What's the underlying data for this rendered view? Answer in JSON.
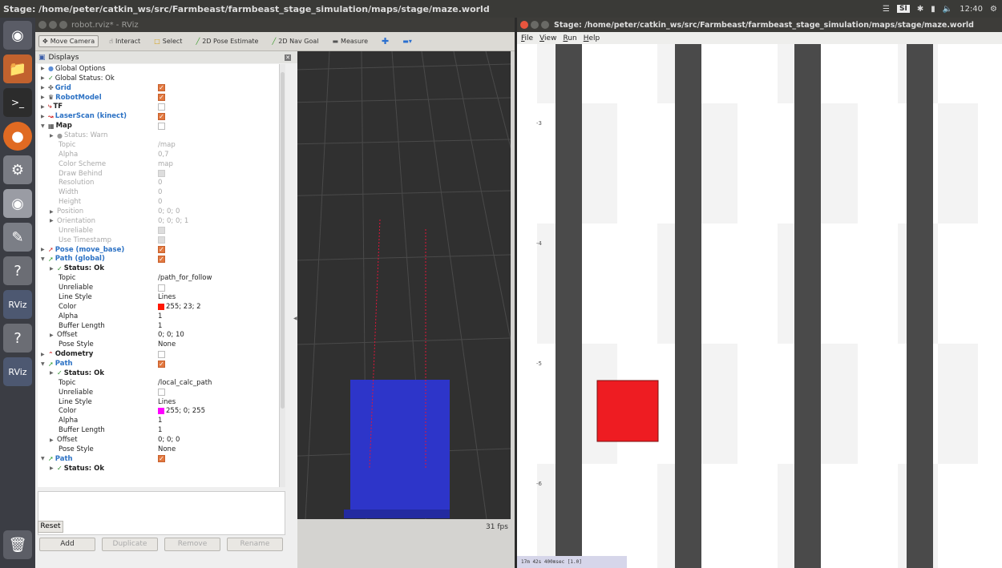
{
  "topbar": {
    "title": "Stage: /home/peter/catkin_ws/src/Farmbeast/farmbeast_stage_simulation/maps/stage/maze.world",
    "tray_badge": "SI",
    "clock": "12:40"
  },
  "launcher": {
    "items": [
      "ubuntu-dash-icon",
      "files-icon",
      "terminal-icon",
      "firefox-icon",
      "settings-icon",
      "camera-icon",
      "text-editor-icon",
      "help-icon",
      "rviz-icon",
      "help-icon",
      "rviz-icon",
      "trash-icon"
    ],
    "rviz_label": "RViz"
  },
  "rviz": {
    "title": "robot.rviz* - RViz",
    "tools": [
      {
        "label": "Move Camera",
        "icon": "move-camera-icon",
        "active": true
      },
      {
        "label": "Interact",
        "icon": "interact-icon"
      },
      {
        "label": "Select",
        "icon": "select-icon"
      },
      {
        "label": "2D Pose Estimate",
        "icon": "pose-estimate-icon"
      },
      {
        "label": "2D Nav Goal",
        "icon": "nav-goal-icon"
      },
      {
        "label": "Measure",
        "icon": "measure-icon"
      }
    ],
    "displays_title": "Displays",
    "rows": [
      {
        "name": "Global Options",
        "kind": "parent",
        "icon": "global-options-icon",
        "expanded": false,
        "indent": 0
      },
      {
        "name": "Global Status: Ok",
        "kind": "parent",
        "icon": "check-icon",
        "expanded": false,
        "indent": 0
      },
      {
        "name": "Grid",
        "kind": "display",
        "icon": "grid-icon",
        "expanded": false,
        "indent": 0,
        "checked": true
      },
      {
        "name": "RobotModel",
        "kind": "display",
        "icon": "robot-model-icon",
        "expanded": false,
        "indent": 0,
        "checked": true
      },
      {
        "name": "TF",
        "kind": "display",
        "icon": "tf-icon",
        "expanded": false,
        "indent": 0,
        "checked": false,
        "plain": true
      },
      {
        "name": "LaserScan (kinect)",
        "kind": "display",
        "icon": "laserscan-icon",
        "expanded": false,
        "indent": 0,
        "checked": true
      },
      {
        "name": "Map",
        "kind": "display",
        "icon": "map-icon",
        "expanded": true,
        "indent": 0,
        "checked": false,
        "plain": true
      },
      {
        "name": "Status: Warn",
        "kind": "prop",
        "icon": "warn-icon",
        "expanded": false,
        "indent": 1,
        "dim": true
      },
      {
        "name": "Topic",
        "value": "/map",
        "indent": 2,
        "dim": true
      },
      {
        "name": "Alpha",
        "value": "0,7",
        "indent": 2,
        "dim": true
      },
      {
        "name": "Color Scheme",
        "value": "map",
        "indent": 2,
        "dim": true
      },
      {
        "name": "Draw Behind",
        "checkbox": "disabled",
        "indent": 2,
        "dim": true
      },
      {
        "name": "Resolution",
        "value": "0",
        "indent": 2,
        "dim": true
      },
      {
        "name": "Width",
        "value": "0",
        "indent": 2,
        "dim": true
      },
      {
        "name": "Height",
        "value": "0",
        "indent": 2,
        "dim": true
      },
      {
        "name": "Position",
        "value": "0; 0; 0",
        "indent": 1,
        "dim": true,
        "expandable": true
      },
      {
        "name": "Orientation",
        "value": "0; 0; 0; 1",
        "indent": 1,
        "dim": true,
        "expandable": true
      },
      {
        "name": "Unreliable",
        "checkbox": "disabled",
        "indent": 2,
        "dim": true
      },
      {
        "name": "Use Timestamp",
        "checkbox": "disabled",
        "indent": 2,
        "dim": true
      },
      {
        "name": "Pose (move_base)",
        "kind": "display",
        "icon": "pose-icon",
        "expanded": false,
        "indent": 0,
        "checked": true
      },
      {
        "name": "Path (global)",
        "kind": "display",
        "icon": "path-icon",
        "expanded": true,
        "indent": 0,
        "checked": true
      },
      {
        "name": "Status: Ok",
        "kind": "prop",
        "icon": "check-icon",
        "expanded": false,
        "indent": 1,
        "bold": true
      },
      {
        "name": "Topic",
        "value": "/path_for_follow",
        "indent": 2
      },
      {
        "name": "Unreliable",
        "checkbox": "off",
        "indent": 2
      },
      {
        "name": "Line Style",
        "value": "Lines",
        "indent": 2
      },
      {
        "name": "Color",
        "value": "255; 23; 2",
        "swatch": "#ff1702",
        "indent": 2
      },
      {
        "name": "Alpha",
        "value": "1",
        "indent": 2
      },
      {
        "name": "Buffer Length",
        "value": "1",
        "indent": 2
      },
      {
        "name": "Offset",
        "value": "0; 0; 10",
        "indent": 1,
        "expandable": true
      },
      {
        "name": "Pose Style",
        "value": "None",
        "indent": 2
      },
      {
        "name": "Odometry",
        "kind": "display",
        "icon": "odometry-icon",
        "expanded": false,
        "indent": 0,
        "checked": false,
        "plain": true
      },
      {
        "name": "Path",
        "kind": "display",
        "icon": "path-icon",
        "expanded": true,
        "indent": 0,
        "checked": true
      },
      {
        "name": "Status: Ok",
        "kind": "prop",
        "icon": "check-icon",
        "expanded": false,
        "indent": 1,
        "bold": true
      },
      {
        "name": "Topic",
        "value": "/local_calc_path",
        "indent": 2
      },
      {
        "name": "Unreliable",
        "checkbox": "off",
        "indent": 2
      },
      {
        "name": "Line Style",
        "value": "Lines",
        "indent": 2
      },
      {
        "name": "Color",
        "value": "255; 0; 255",
        "swatch": "#ff00ff",
        "indent": 2
      },
      {
        "name": "Alpha",
        "value": "1",
        "indent": 2
      },
      {
        "name": "Buffer Length",
        "value": "1",
        "indent": 2
      },
      {
        "name": "Offset",
        "value": "0; 0; 0",
        "indent": 1,
        "expandable": true
      },
      {
        "name": "Pose Style",
        "value": "None",
        "indent": 2
      },
      {
        "name": "Path",
        "kind": "display",
        "icon": "path-icon",
        "expanded": true,
        "indent": 0,
        "checked": true
      },
      {
        "name": "Status: Ok",
        "kind": "prop",
        "icon": "check-icon",
        "expanded": false,
        "indent": 1,
        "bold": true
      }
    ],
    "buttons": {
      "add": "Add",
      "duplicate": "Duplicate",
      "remove": "Remove",
      "rename": "Rename"
    },
    "reset": "Reset",
    "fps": "31 fps"
  },
  "stage": {
    "title": "Stage: /home/peter/catkin_ws/src/Farmbeast/farmbeast_stage_simulation/maps/stage/maze.world",
    "menu": [
      "File",
      "View",
      "Run",
      "Help"
    ],
    "y_ticks": [
      "-3",
      "-4",
      "-5",
      "-6"
    ],
    "status": "17m 42s 400msec [1.0]",
    "colors": {
      "wall": "#4a4a4a",
      "robot": "#ee1c22",
      "bg": "#ffffff",
      "checker": "#f3f3f3"
    }
  }
}
